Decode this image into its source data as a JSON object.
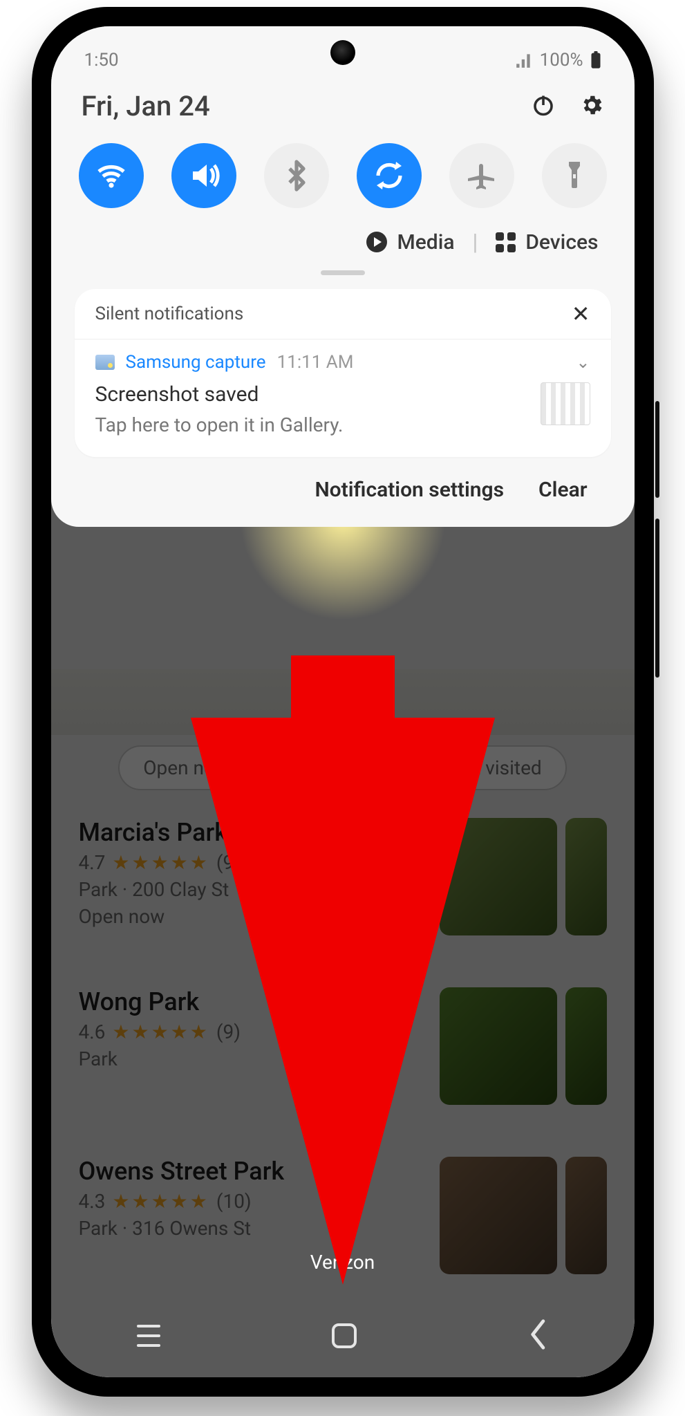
{
  "status_bar": {
    "time": "1:50",
    "battery_label": "100%"
  },
  "header": {
    "date": "Fri, Jan 24"
  },
  "quick_settings": {
    "wifi": {
      "active": true
    },
    "sound": {
      "active": true
    },
    "bluetooth": {
      "active": false
    },
    "rotate": {
      "active": true
    },
    "airplane": {
      "active": false
    },
    "flashlight": {
      "active": false
    }
  },
  "media_row": {
    "media": "Media",
    "devices": "Devices"
  },
  "silent": {
    "header": "Silent notifications"
  },
  "notification": {
    "app": "Samsung capture",
    "time": "11:11 AM",
    "title": "Screenshot saved",
    "subtitle": "Tap here to open it in Gallery."
  },
  "actions": {
    "settings": "Notification settings",
    "clear": "Clear"
  },
  "bg": {
    "chips": [
      "Open now",
      "",
      "Haven't visited"
    ],
    "results": [
      {
        "title": "Marcia's Park",
        "rating": "4.7",
        "stars": "★★★★★",
        "count": "(9)",
        "line": "Park · 200 Clay St",
        "extra": "Open now"
      },
      {
        "title": "Wong Park",
        "rating": "4.6",
        "stars": "★★★★★",
        "count": "(9)",
        "line": "Park",
        "extra": ""
      },
      {
        "title": "Owens Street Park",
        "rating": "4.3",
        "stars": "★★★★★",
        "count": "(10)",
        "line": "Park · 316 Owens St",
        "extra": ""
      }
    ],
    "carrier": "Verizon"
  }
}
